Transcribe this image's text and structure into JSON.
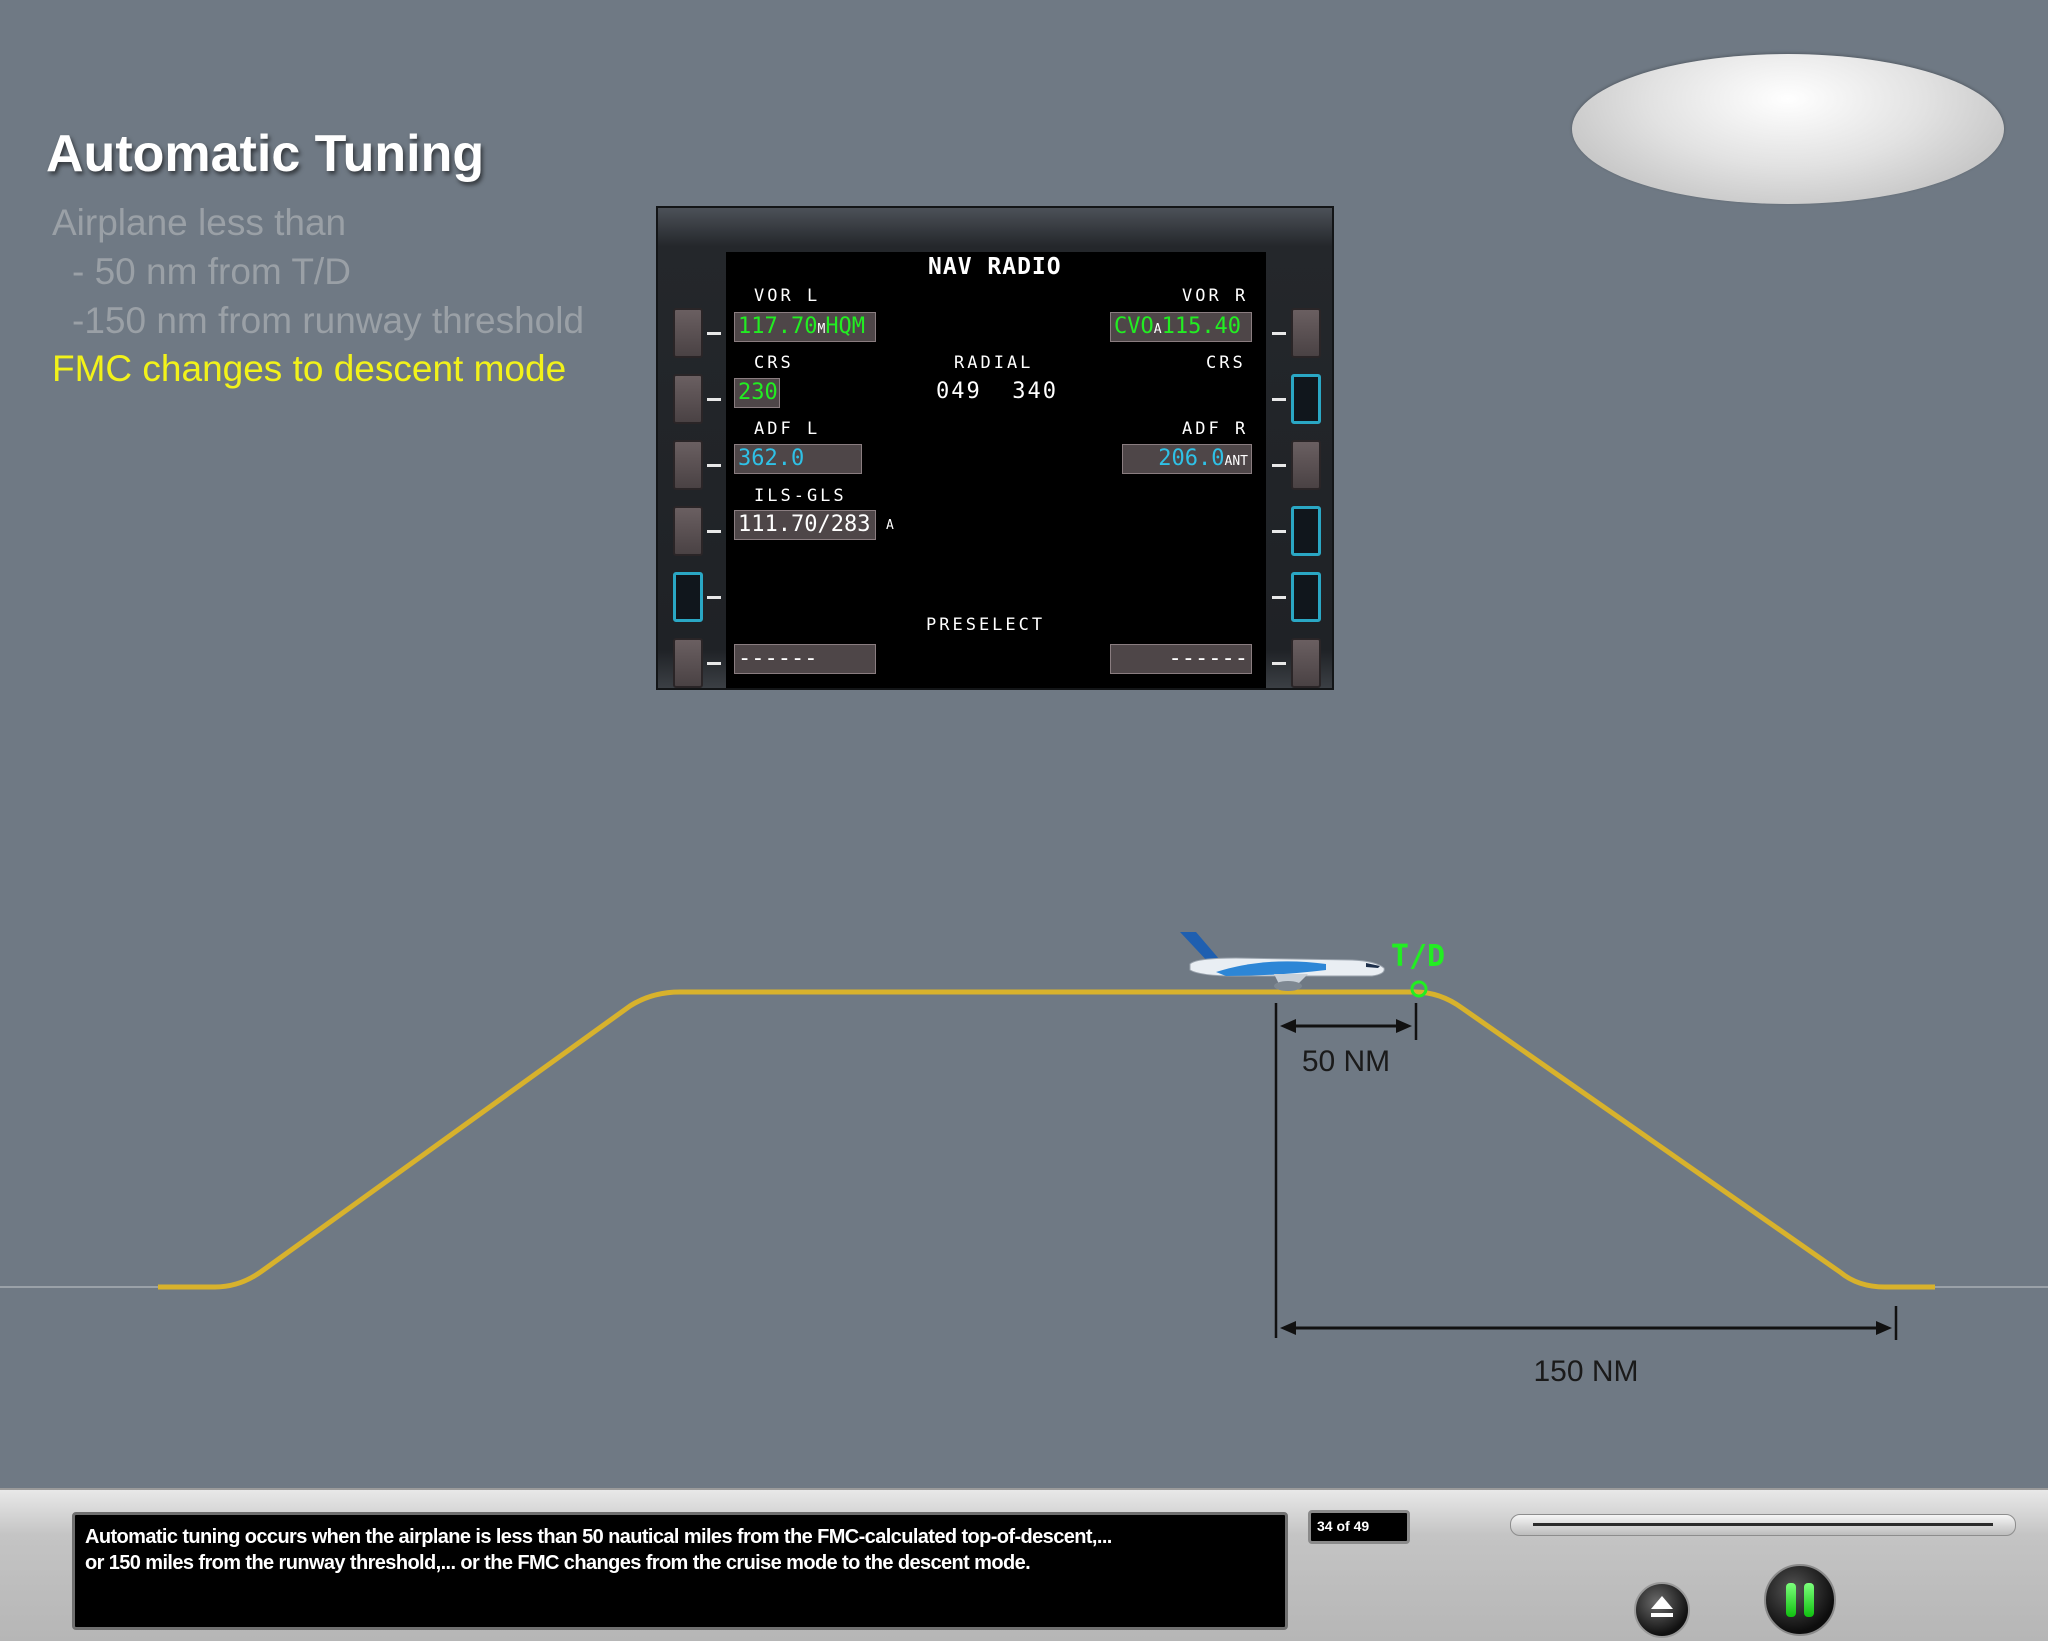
{
  "slide": {
    "title": "Automatic Tuning",
    "bullets": [
      "Airplane less than",
      "- 50 nm from T/D",
      "-150 nm from runway threshold"
    ],
    "highlight": "FMC changes to descent mode"
  },
  "cdu": {
    "page_title": "NAV RADIO",
    "vor_l_label": "VOR L",
    "vor_l_freq": "117.70",
    "vor_l_mode": "M",
    "vor_l_ident": "HQM",
    "vor_r_label": "VOR R",
    "vor_r_ident": "CVO",
    "vor_r_mode": "A",
    "vor_r_freq": "115.40",
    "crs_left_label": "CRS",
    "crs_left_value": "230",
    "radial_label": "RADIAL",
    "radial_values": "049  340",
    "crs_right_label": "CRS",
    "adf_l_label": "ADF L",
    "adf_l_value": "362.0",
    "adf_r_label": "ADF R",
    "adf_r_value": "206.0",
    "adf_r_mode": "ANT",
    "ils_label": "ILS-GLS",
    "ils_value": "111.70/283",
    "ils_mode": "A",
    "preselect_label": "PRESELECT",
    "preselect_left": "------",
    "preselect_right": "------"
  },
  "profile": {
    "td_label": "T/D",
    "distance_short": "50 NM",
    "distance_long": "150 NM"
  },
  "colors": {
    "background": "#6f7984",
    "path": "#d8b22c",
    "highlight": "#f2f21a",
    "cdu_green": "#22ee22",
    "cdu_cyan": "#2fc1e6",
    "td_marker": "#22ee22"
  },
  "player": {
    "caption_line1": "Automatic tuning occurs when the airplane is less than 50 nautical miles from the FMC-calculated top-of-descent,...",
    "caption_line2": "or 150 miles from the runway threshold,... or the FMC changes from the cruise mode to the descent mode.",
    "page_counter": "34 of 49",
    "eject_icon": "eject-icon",
    "pause_icon": "pause-icon"
  }
}
